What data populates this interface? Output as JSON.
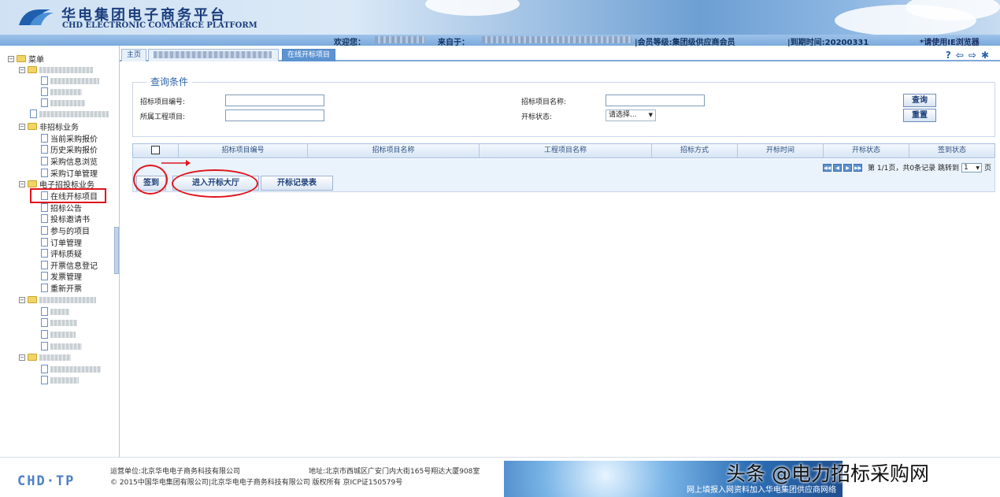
{
  "header": {
    "title": "华电集团电子商务平台",
    "subtitle": "CHD ELECTRONIC COMMERCE PLATFORM",
    "welcome_label": "欢迎您：",
    "from_label": "来自于：",
    "member_level": "|会员等级:集团级供应商会员",
    "expire": "|到期时间:20200331",
    "ie_notice": "*请使用IE浏览器"
  },
  "tabs": {
    "home": "主页",
    "current": "在线开标项目"
  },
  "sidebar": {
    "root": "菜单",
    "group_non_bid": "非招标业务",
    "non_bid_items": [
      "当前采购报价",
      "历史采购报价",
      "采购信息浏览",
      "采购订单管理"
    ],
    "group_ebid": "电子招投标业务",
    "ebid_items": [
      "在线开标项目",
      "招标公告",
      "投标邀请书",
      "参与的项目",
      "订单管理",
      "评标质疑",
      "开票信息登记",
      "发票管理",
      "重新开票"
    ]
  },
  "query": {
    "legend": "查询条件",
    "bid_no_label": "招标项目编号:",
    "project_label": "所属工程项目:",
    "bid_name_label": "招标项目名称:",
    "status_label": "开标状态:",
    "status_value": "请选择...",
    "search_btn": "查询",
    "reset_btn": "重置"
  },
  "grid": {
    "columns": [
      "招标项目编号",
      "招标项目名称",
      "工程项目名称",
      "招标方式",
      "开标时间",
      "开标状态",
      "签到状态"
    ],
    "pager": "第 1/1页，共0条记录 跳转到",
    "page_select": "1",
    "page_unit": "页"
  },
  "actions": {
    "sign_in": "签到",
    "enter_hall": "进入开标大厅",
    "records": "开标记录表"
  },
  "footer": {
    "logo": "CHD·TP",
    "operator": "运营单位:北京华电电子商务科技有限公司",
    "address": "地址:北京市西城区广安门内大街165号翔达大厦908室",
    "copyright": "© 2015中国华电集团有限公司|北京华电电子商务科技有限公司 版权所有 京ICP证150579号",
    "banner_text": "网上填报入网资料加入华电集团供应商网络"
  },
  "watermark": "头条 @电力招标采购网",
  "colors": {
    "accent": "#2e63a8",
    "annotation": "#e0141e"
  }
}
